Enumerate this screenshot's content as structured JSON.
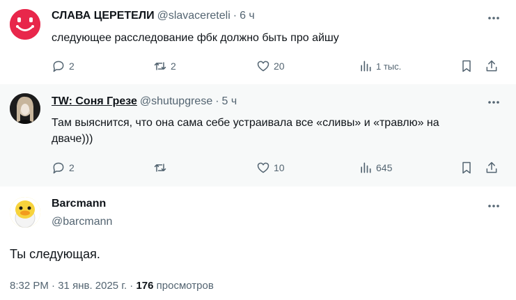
{
  "tweets": [
    {
      "name": "СЛАВА ЦЕРЕТЕЛИ",
      "handle": "@slavacereteli",
      "time": "6 ч",
      "text": "следующее расследование фбк должно быть про айшу",
      "replies": "2",
      "retweets": "2",
      "likes": "20",
      "views": "1 тыс."
    },
    {
      "name": "TW: Соня Грезе",
      "handle": "@shutupgrese",
      "time": "5 ч",
      "text_line1": "Там выяснится, что она сама себе устраивала все «сливы» и «травлю» на",
      "text_line2": "дваче)))",
      "replies": "2",
      "likes": "10",
      "views": "645"
    }
  ],
  "main_tweet": {
    "name": "Barcmann",
    "handle": "@barcmann",
    "text": "Ты следующая.",
    "time": "8:32 PM",
    "date": "31 янв. 2025 г.",
    "views_count": "176",
    "views_label": "просмотров"
  },
  "colors": {
    "text": "#0f1419",
    "secondary": "#536471",
    "thread_line": "#cfd9de",
    "avatar1_bg": "#e8274b",
    "avatar3_bg": "#f7d33c"
  },
  "icons": [
    "reply-icon",
    "retweet-icon",
    "like-icon",
    "views-icon",
    "bookmark-icon",
    "share-icon",
    "more-icon"
  ]
}
